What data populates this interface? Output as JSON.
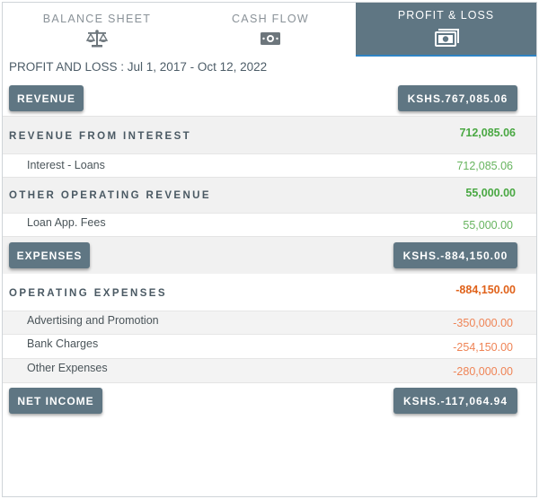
{
  "tabs": [
    {
      "label": "BALANCE SHEET",
      "icon": "scale-icon",
      "active": false
    },
    {
      "label": "CASH FLOW",
      "icon": "banknote-icon",
      "active": false
    },
    {
      "label": "PROFIT & LOSS",
      "icon": "money-stack-icon",
      "active": true
    }
  ],
  "period": "PROFIT AND LOSS : Jul 1, 2017 - Oct 12, 2022",
  "revenue": {
    "button_label": "REVENUE",
    "total": "KSHS.767,085.06",
    "sections": [
      {
        "title": "REVENUE FROM INTEREST",
        "value": "712,085.06",
        "items": [
          {
            "label": "Interest - Loans",
            "value": "712,085.06"
          }
        ]
      },
      {
        "title": "OTHER OPERATING REVENUE",
        "value": "55,000.00",
        "items": [
          {
            "label": "Loan App. Fees",
            "value": "55,000.00"
          }
        ]
      }
    ]
  },
  "expenses": {
    "button_label": "EXPENSES",
    "total": "KSHS.-884,150.00",
    "sections": [
      {
        "title": "OPERATING EXPENSES",
        "value": "-884,150.00",
        "items": [
          {
            "label": "Advertising and Promotion",
            "value": "-350,000.00"
          },
          {
            "label": "Bank Charges",
            "value": "-254,150.00"
          },
          {
            "label": "Other Expenses",
            "value": "-280,000.00"
          }
        ]
      }
    ]
  },
  "net_income": {
    "button_label": "NET INCOME",
    "total": "KSHS.-117,064.94"
  },
  "colors": {
    "accent": "#5f7683",
    "positive": "#4aa843",
    "negative": "#e0621a"
  }
}
